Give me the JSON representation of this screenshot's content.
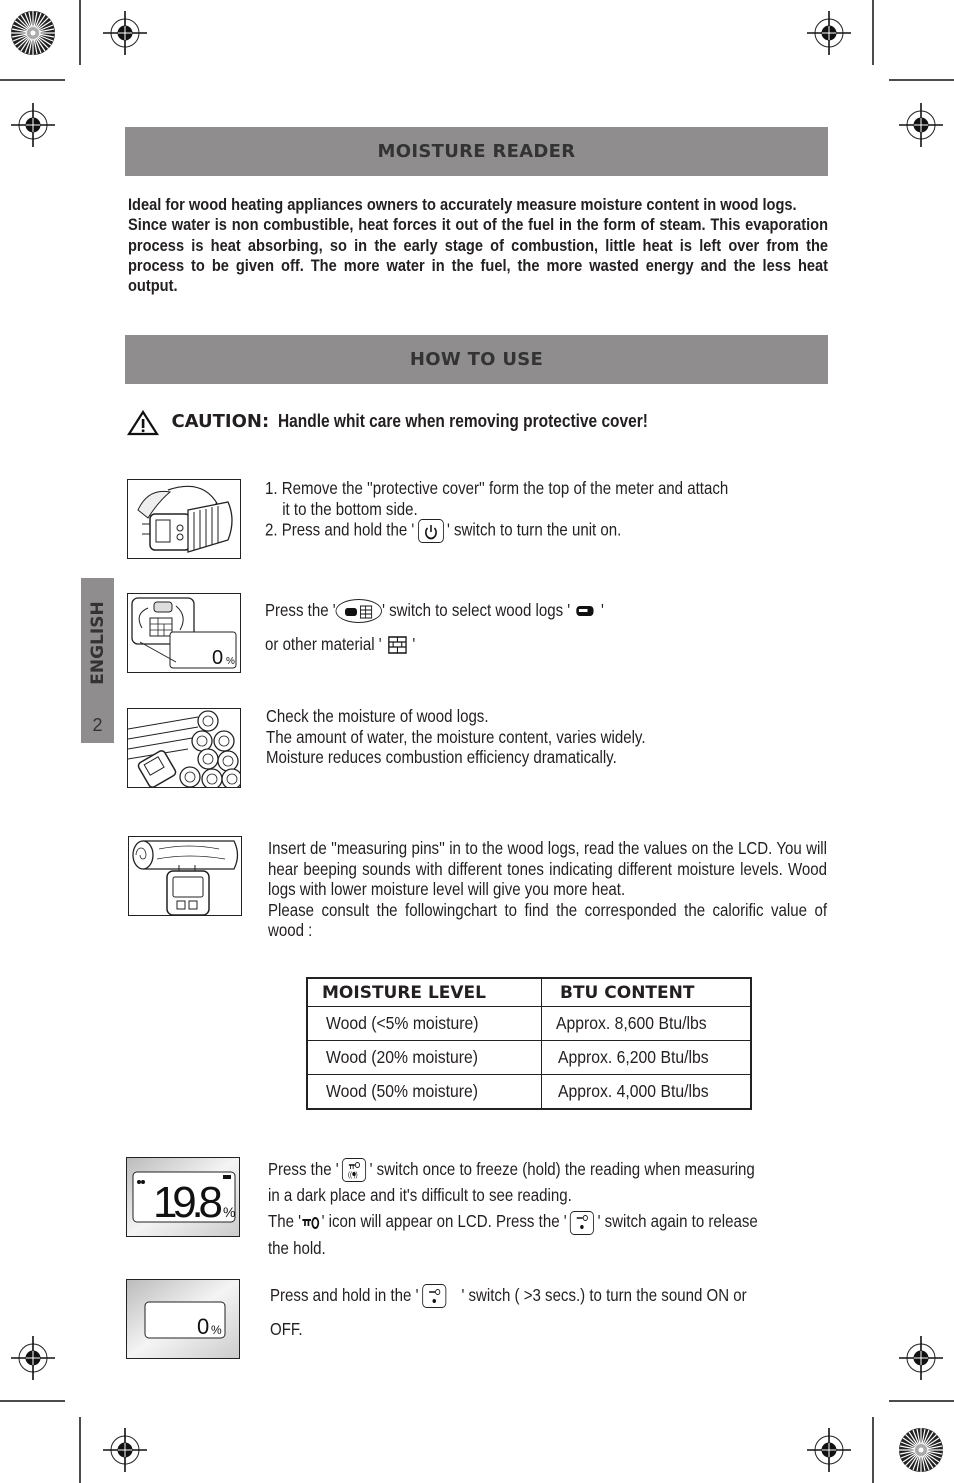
{
  "section1": {
    "title": "MOISTURE READER",
    "intro": "Ideal for wood heating appliances owners to accurately measure moisture content in wood logs.",
    "body": "Since water is non combustible, heat forces it out of the fuel in the form of steam. This evaporation process is heat absorbing, so in the early stage of combustion, little heat is left over from the process to be given off. The more water in the fuel, the more wasted energy and the less heat output."
  },
  "section2": {
    "title": "HOW TO USE",
    "caution_label": "CAUTION:",
    "caution_text": "Handle whit care when removing protective cover!"
  },
  "side_tab": {
    "language": "ENGLISH",
    "page_number": "2"
  },
  "steps": [
    {
      "line1": "1. Remove the ''protective cover'' form the top of the meter and attach",
      "line2": "it to the bottom side.",
      "line3a": "2. Press and hold the '",
      "line3b": "' switch to turn the unit on.",
      "icon": "power-button-icon"
    },
    {
      "line1a": "Press the '",
      "line1b": "' switch to select wood logs '",
      "line1c": "'",
      "line2a": "or other material '",
      "line2b": "'",
      "lcd_value": "0",
      "lcd_unit": "%"
    },
    {
      "lines": [
        "Check the moisture of wood logs.",
        "The amount of water, the moisture content, varies widely.",
        "Moisture reduces combustion efficiency dramatically."
      ]
    },
    {
      "text": "Insert de ''measuring pins'' in to the wood logs, read the values on the LCD. You will hear beeping sounds with different tones indicating different moisture levels. Wood logs with lower moisture level will give you more heat.",
      "text2": "Please consult the followingchart to find the corresponded the calorific value of wood :"
    },
    {
      "l1a": "Press the '",
      "l1b": "' switch once to freeze (hold) the reading when measuring",
      "l2": "in a dark place and it's difficult to see reading.",
      "l3a": "The '",
      "l3b": "' icon will appear on LCD. Press the '",
      "l3c": "' switch again to release",
      "l4": "the hold.",
      "lcd_value": "19.8",
      "lcd_unit": "%"
    },
    {
      "l1a": "Press and hold in the '",
      "l1b": "' switch ( >3 secs.) to turn the sound ON or",
      "l2": "OFF.",
      "lcd_value": "0",
      "lcd_unit": "%"
    }
  ],
  "btu_table": {
    "headers": [
      "MOISTURE LEVEL",
      "BTU CONTENT"
    ],
    "rows": [
      [
        "Wood (<5% moisture)",
        "Approx. 8,600 Btu/lbs"
      ],
      [
        "Wood (20% moisture)",
        "Approx. 6,200 Btu/lbs"
      ],
      [
        "Wood (50% moisture)",
        "Approx. 4,000 Btu/lbs"
      ]
    ]
  },
  "colors": {
    "band": "#8f8d8e",
    "text": "#231f20"
  }
}
